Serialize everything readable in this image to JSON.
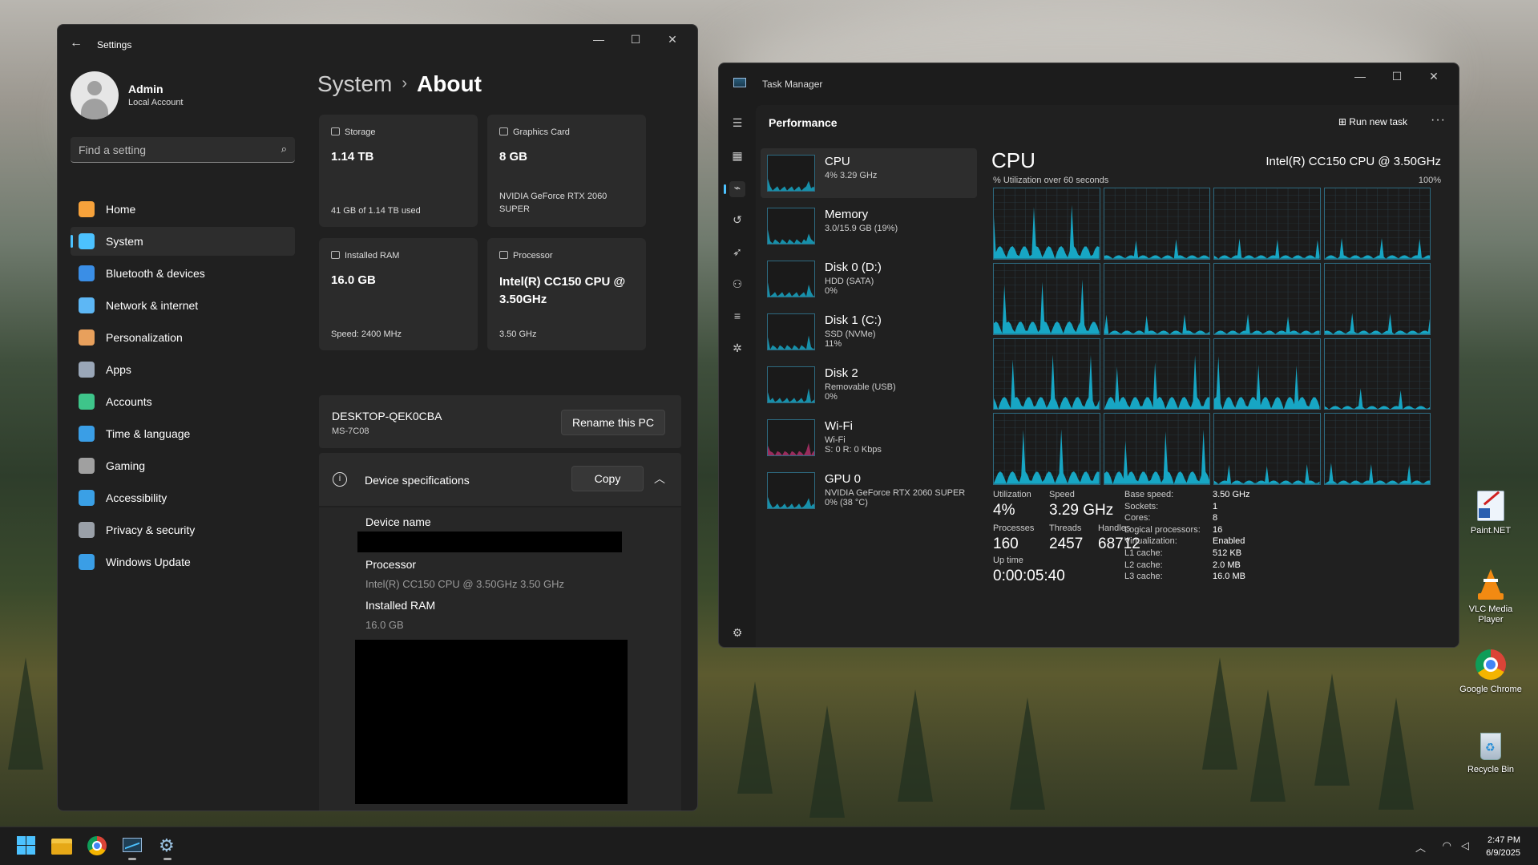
{
  "settings": {
    "window_title": "Settings",
    "user": {
      "name": "Admin",
      "account": "Local Account"
    },
    "search_placeholder": "Find a setting",
    "nav": [
      {
        "label": "Home",
        "icon": "home-icon",
        "color": "#f7a23b"
      },
      {
        "label": "System",
        "icon": "system-icon",
        "color": "#4cc2ff"
      },
      {
        "label": "Bluetooth & devices",
        "icon": "bluetooth-icon",
        "color": "#3a8ee6"
      },
      {
        "label": "Network & internet",
        "icon": "network-icon",
        "color": "#5db7f5"
      },
      {
        "label": "Personalization",
        "icon": "brush-icon",
        "color": "#e8a05c"
      },
      {
        "label": "Apps",
        "icon": "apps-icon",
        "color": "#9aa7b8"
      },
      {
        "label": "Accounts",
        "icon": "accounts-icon",
        "color": "#3ec58a"
      },
      {
        "label": "Time & language",
        "icon": "globe-icon",
        "color": "#3a9ee6"
      },
      {
        "label": "Gaming",
        "icon": "gamepad-icon",
        "color": "#a0a0a0"
      },
      {
        "label": "Accessibility",
        "icon": "accessibility-icon",
        "color": "#3aa0e6"
      },
      {
        "label": "Privacy & security",
        "icon": "shield-icon",
        "color": "#9aa0a8"
      },
      {
        "label": "Windows Update",
        "icon": "update-icon",
        "color": "#3a9ee6"
      }
    ],
    "breadcrumb": {
      "parent": "System",
      "current": "About"
    },
    "cards": {
      "storage": {
        "title": "Storage",
        "value": "1.14 TB",
        "sub": "41 GB of 1.14 TB used"
      },
      "graphics": {
        "title": "Graphics Card",
        "value": "8 GB",
        "sub": "NVIDIA GeForce RTX 2060 SUPER"
      },
      "ram": {
        "title": "Installed RAM",
        "value": "16.0 GB",
        "sub": "Speed: 2400 MHz"
      },
      "processor": {
        "title": "Processor",
        "value": "Intel(R) CC150 CPU @ 3.50GHz",
        "sub": "3.50 GHz"
      }
    },
    "pc": {
      "name": "DESKTOP-QEK0CBA",
      "model": "MS-7C08",
      "rename_label": "Rename this PC"
    },
    "specs": {
      "title": "Device specifications",
      "copy_label": "Copy",
      "device_name_label": "Device name",
      "processor_label": "Processor",
      "processor_value": "Intel(R) CC150 CPU @ 3.50GHz   3.50 GHz",
      "ram_label": "Installed RAM",
      "ram_value": "16.0 GB"
    }
  },
  "taskmanager": {
    "window_title": "Task Manager",
    "page_title": "Performance",
    "run_new_task": "Run new task",
    "items": [
      {
        "name": "CPU",
        "sub1": "4% 3.29 GHz",
        "sub2": "",
        "sub3": ""
      },
      {
        "name": "Memory",
        "sub1": "3.0/15.9 GB (19%)",
        "sub2": "",
        "sub3": ""
      },
      {
        "name": "Disk 0 (D:)",
        "sub1": "HDD (SATA)",
        "sub2": "0%",
        "sub3": ""
      },
      {
        "name": "Disk 1 (C:)",
        "sub1": "SSD (NVMe)",
        "sub2": "11%",
        "sub3": ""
      },
      {
        "name": "Disk 2",
        "sub1": "Removable (USB)",
        "sub2": "0%",
        "sub3": ""
      },
      {
        "name": "Wi-Fi",
        "sub1": "Wi-Fi",
        "sub2": "S: 0 R: 0 Kbps",
        "sub3": ""
      },
      {
        "name": "GPU 0",
        "sub1": "NVIDIA GeForce RTX 2060 SUPER",
        "sub2": "0% (38 °C)",
        "sub3": ""
      }
    ],
    "cpu": {
      "title": "CPU",
      "model": "Intel(R) CC150 CPU @ 3.50GHz",
      "graph_label": "% Utilization over 60 seconds",
      "graph_max": "100%",
      "utilization_label": "Utilization",
      "utilization": "4%",
      "speed_label": "Speed",
      "speed": "3.29 GHz",
      "processes_label": "Processes",
      "processes": "160",
      "threads_label": "Threads",
      "threads": "2457",
      "handles_label": "Handles",
      "handles": "68712",
      "uptime_label": "Up time",
      "uptime": "0:00:05:40",
      "details": [
        {
          "k": "Base speed:",
          "v": "3.50 GHz"
        },
        {
          "k": "Sockets:",
          "v": "1"
        },
        {
          "k": "Cores:",
          "v": "8"
        },
        {
          "k": "Logical processors:",
          "v": "16"
        },
        {
          "k": "Virtualization:",
          "v": "Enabled"
        },
        {
          "k": "L1 cache:",
          "v": "512 KB"
        },
        {
          "k": "L2 cache:",
          "v": "2.0 MB"
        },
        {
          "k": "L3 cache:",
          "v": "16.0 MB"
        }
      ]
    },
    "accent_color": "#17a6c4"
  },
  "desktop_icons": [
    {
      "label": "Paint.NET",
      "icon": "paintnet-icon"
    },
    {
      "label": "VLC Media Player",
      "icon": "vlc-icon"
    },
    {
      "label": "Google Chrome",
      "icon": "chrome-icon"
    },
    {
      "label": "Recycle Bin",
      "icon": "recycle-bin-icon"
    }
  ],
  "taskbar": {
    "time": "2:47 PM",
    "date": "6/9/2025",
    "apps": [
      "start-icon",
      "file-explorer-icon",
      "chrome-icon",
      "task-manager-icon",
      "settings-icon"
    ]
  }
}
